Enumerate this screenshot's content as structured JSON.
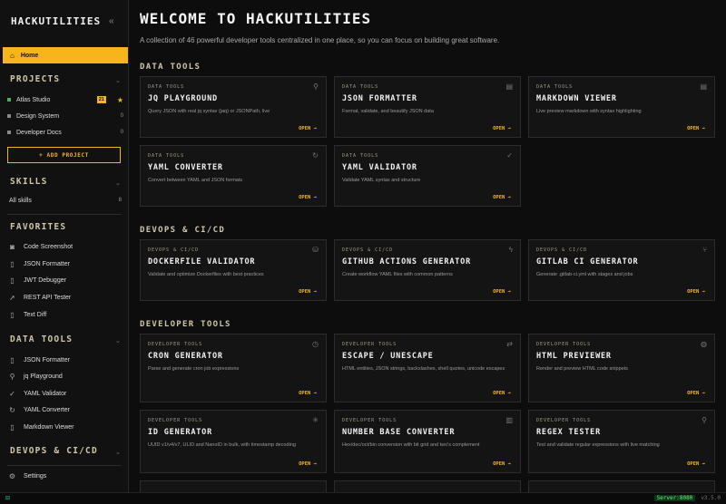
{
  "sidebar": {
    "brand": "HACKUTILITIES",
    "collapse_icon": "«",
    "home_label": "Home",
    "projects_title": "PROJECTS",
    "projects": [
      {
        "name": "Atlas Studio",
        "badge": "21",
        "color": "#4caf50",
        "count": ""
      },
      {
        "name": "Design System",
        "badge": "",
        "color": "#888888",
        "count": "0"
      },
      {
        "name": "Developer Docs",
        "badge": "",
        "color": "#888888",
        "count": "0"
      }
    ],
    "add_project_label": "+ ADD PROJECT",
    "skills_title": "SKILLS",
    "skills_all_label": "All skills",
    "skills_count": "8",
    "favorites_title": "FAVORITES",
    "favorites": [
      "Code Screenshot",
      "JSON Formatter",
      "JWT Debugger",
      "REST API Tester",
      "Text Diff"
    ],
    "data_tools_title": "DATA TOOLS",
    "data_tools": [
      "JSON Formatter",
      "jq Playground",
      "YAML Validator",
      "YAML Converter",
      "Markdown Viewer"
    ],
    "devops_title": "DEVOPS & CI/CD",
    "settings_label": "Settings"
  },
  "main": {
    "title": "WELCOME TO HACKUTILITIES",
    "subtitle": "A collection of 46 powerful developer tools centralized in one place, so you can focus on building great software.",
    "open_label": "OPEN →",
    "categories": [
      {
        "title": "DATA TOOLS",
        "tag": "DATA TOOLS",
        "tools": [
          {
            "name": "JQ PLAYGROUND",
            "desc": "Query JSON with real jq syntax (jaq) or JSONPath, live",
            "icon": "search-icon"
          },
          {
            "name": "JSON FORMATTER",
            "desc": "Format, validate, and beautify JSON data",
            "icon": "file-icon"
          },
          {
            "name": "MARKDOWN VIEWER",
            "desc": "Live preview markdown with syntax highlighting",
            "icon": "file-icon"
          },
          {
            "name": "YAML CONVERTER",
            "desc": "Convert between YAML and JSON formats",
            "icon": "refresh-icon"
          },
          {
            "name": "YAML VALIDATOR",
            "desc": "Validate YAML syntax and structure",
            "icon": "check-icon"
          }
        ]
      },
      {
        "title": "DEVOPS & CI/CD",
        "tag": "DEVOPS & CI/CD",
        "tools": [
          {
            "name": "DOCKERFILE VALIDATOR",
            "desc": "Validate and optimize Dockerfiles with best practices",
            "icon": "database-icon"
          },
          {
            "name": "GITHUB ACTIONS GENERATOR",
            "desc": "Create workflow YAML files with common patterns",
            "icon": "bolt-icon"
          },
          {
            "name": "GITLAB CI GENERATOR",
            "desc": "Generate .gitlab-ci.yml with stages and jobs",
            "icon": "branch-icon"
          }
        ]
      },
      {
        "title": "DEVELOPER TOOLS",
        "tag": "DEVELOPER TOOLS",
        "tools": [
          {
            "name": "CRON GENERATOR",
            "desc": "Parse and generate cron job expressions",
            "icon": "clock-icon"
          },
          {
            "name": "ESCAPE / UNESCAPE",
            "desc": "HTML entities, JSON strings, backslashes, shell quotes, unicode escapes",
            "icon": "arrows-icon"
          },
          {
            "name": "HTML PREVIEWER",
            "desc": "Render and preview HTML code snippets",
            "icon": "globe-icon"
          },
          {
            "name": "ID GENERATOR",
            "desc": "UUID v1/v4/v7, ULID and NanoID in bulk, with timestamp decoding",
            "icon": "sparkle-icon"
          },
          {
            "name": "NUMBER BASE CONVERTER",
            "desc": "Hex/dec/oct/bin conversion with bit grid and two's complement",
            "icon": "bars-icon"
          },
          {
            "name": "REGEX TESTER",
            "desc": "Test and validate regular expressions with live matching",
            "icon": "search-icon"
          }
        ]
      }
    ]
  },
  "status": {
    "left_icon": "⊟",
    "server_label": "Server:8080",
    "version": "v3.5.0"
  },
  "colors": {
    "accent": "#f5b51b",
    "background": "#0d0d0d",
    "card": "#141414"
  }
}
